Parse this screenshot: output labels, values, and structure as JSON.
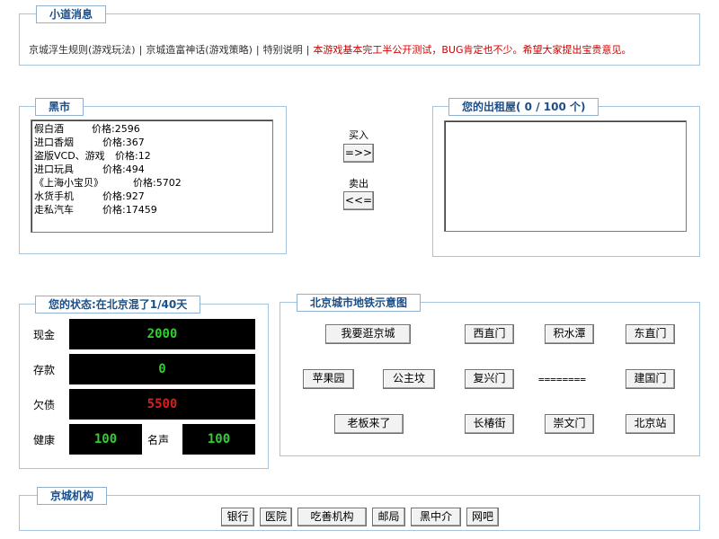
{
  "news": {
    "title": "小道消息",
    "links": [
      "京城浮生规则(游戏玩法)",
      "京城造富神话(游戏策略)",
      "特别说明"
    ],
    "separator": "|",
    "notice": "本游戏基本完工半公开测试，BUG肯定也不少。希望大家提出宝贵意见。"
  },
  "market": {
    "title": "黑市",
    "price_label": "价格:",
    "items": [
      {
        "name": "假白酒",
        "price": "2596"
      },
      {
        "name": "进口香烟",
        "price": "367"
      },
      {
        "name": "盗版VCD、游戏",
        "price": "12"
      },
      {
        "name": "进口玩具",
        "price": "494"
      },
      {
        "name": "《上海小宝贝》",
        "price": "5702"
      },
      {
        "name": "水货手机",
        "price": "927"
      },
      {
        "name": "走私汽车",
        "price": "17459"
      }
    ]
  },
  "trade": {
    "buy_label": "买入",
    "buy_button": "=>>",
    "sell_label": "卖出",
    "sell_button": "<<="
  },
  "rental": {
    "title": "您的出租屋( 0 / 100 个)"
  },
  "status": {
    "title": "您的状态:在北京混了1/40天",
    "cash_label": "现金",
    "cash": "2000",
    "deposit_label": "存款",
    "deposit": "0",
    "debt_label": "欠债",
    "debt": "5500",
    "health_label": "健康",
    "health": "100",
    "fame_label": "名声",
    "fame": "100",
    "colors": {
      "normal": "#33cc33",
      "debt": "#cc2222"
    }
  },
  "subway": {
    "title": "北京城市地铁示意图",
    "stations": {
      "stroll": "我要逛京城",
      "xizhimen": "西直门",
      "jishuitan": "积水潭",
      "dongzhimen": "东直门",
      "pingguoyuan": "苹果园",
      "gongzhufen": "公主坟",
      "fuxingmen": "复兴门",
      "line": "========",
      "jianguomen": "建国门",
      "boss": "老板来了",
      "changchunjie": "长椿街",
      "chongwenmen": "崇文门",
      "beijingzhan": "北京站"
    }
  },
  "institutions": {
    "title": "京城机构",
    "buttons": [
      "银行",
      "医院",
      "吃善机构",
      "邮局",
      "黑中介",
      "网吧"
    ]
  }
}
